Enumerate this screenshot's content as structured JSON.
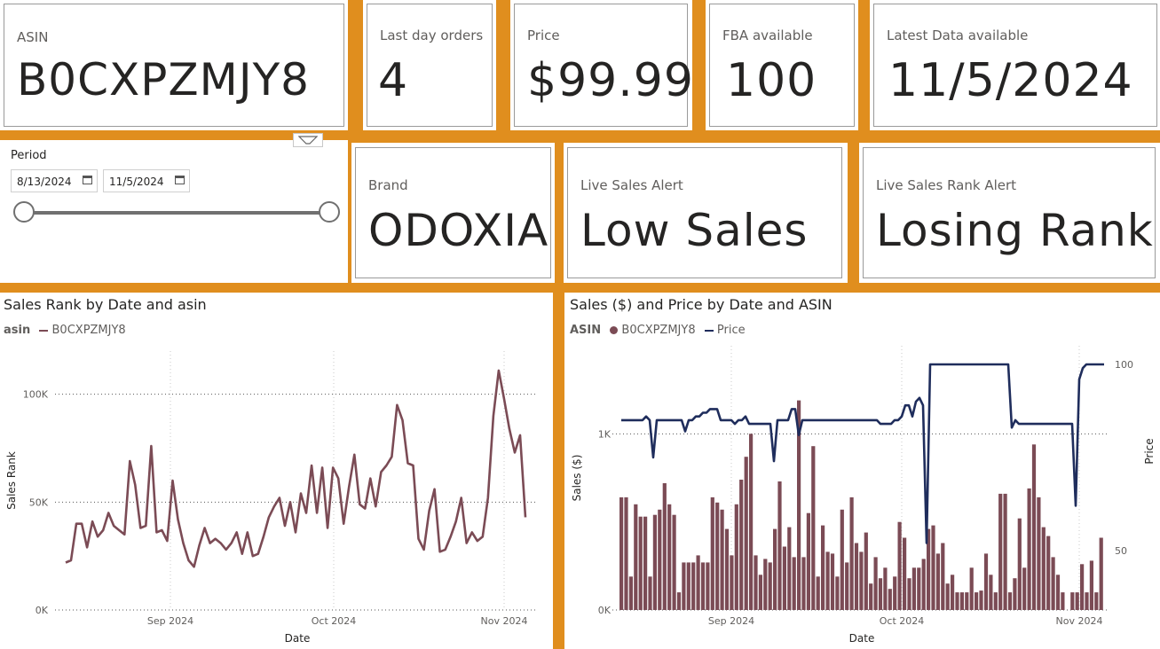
{
  "cards_top": [
    {
      "label": "ASIN",
      "value": "B0CXPZMJY8"
    },
    {
      "label": "Last day orders",
      "value": "4"
    },
    {
      "label": "Price",
      "value": "$99.99"
    },
    {
      "label": "FBA available",
      "value": "100"
    },
    {
      "label": "Latest Data available",
      "value": "11/5/2024"
    }
  ],
  "cards_mid": [
    {
      "label": "Brand",
      "value": "ODOXIA"
    },
    {
      "label": "Live Sales Alert",
      "value": "Low Sales"
    },
    {
      "label": "Live Sales Rank Alert",
      "value": "Losing Rank"
    }
  ],
  "period": {
    "label": "Period",
    "start": "8/13/2024",
    "end": "11/5/2024",
    "icon": "calendar-icon",
    "filter_icon": "filter-icon"
  },
  "colors": {
    "accent": "#E08E1E",
    "series_maroon": "#7B4B55",
    "series_navy": "#1F2D5C"
  },
  "chart_data": [
    {
      "type": "line",
      "title": "Sales Rank by Date and asin",
      "legend_title": "asin",
      "xlabel": "Date",
      "ylabel": "Sales Rank",
      "x_ticks": [
        "Sep 2024",
        "Oct 2024",
        "Nov 2024"
      ],
      "y_ticks": [
        "0K",
        "50K",
        "100K"
      ],
      "ylim": [
        0,
        120000
      ],
      "series": [
        {
          "name": "B0CXPZMJY8",
          "values": [
            22000,
            23000,
            40000,
            40000,
            29000,
            41000,
            34000,
            37000,
            45000,
            39000,
            37000,
            35000,
            69000,
            58000,
            38000,
            39000,
            76000,
            36000,
            37000,
            32000,
            60000,
            42000,
            31000,
            23000,
            20000,
            30000,
            38000,
            31000,
            33000,
            31000,
            28000,
            31000,
            36000,
            26000,
            36000,
            25000,
            26000,
            34000,
            43000,
            48000,
            52000,
            39000,
            50000,
            36000,
            54000,
            45000,
            67000,
            45000,
            66000,
            38000,
            66000,
            61000,
            40000,
            57000,
            72000,
            49000,
            47000,
            61000,
            48000,
            64000,
            67000,
            71000,
            95000,
            88000,
            68000,
            67000,
            33000,
            28000,
            46000,
            56000,
            27000,
            28000,
            34000,
            41000,
            52000,
            31000,
            36000,
            32000,
            34000,
            52000,
            90000,
            111000,
            98000,
            84000,
            73000,
            81000,
            43000
          ]
        }
      ]
    },
    {
      "type": "bar",
      "title": "Sales ($) and Price by Date and ASIN",
      "legend_title": "ASIN",
      "xlabel": "Date",
      "ylabel": "Sales ($)",
      "y2label": "Price",
      "x_ticks": [
        "Sep 2024",
        "Oct 2024",
        "Nov 2024"
      ],
      "y_ticks": [
        "0K",
        "1K"
      ],
      "y2_ticks": [
        "50",
        "100"
      ],
      "ylim": [
        0,
        1500
      ],
      "y2lim": [
        34,
        105
      ],
      "series": [
        {
          "name": "B0CXPZMJY8",
          "type": "bar",
          "values": [
            640,
            640,
            190,
            600,
            530,
            530,
            190,
            540,
            570,
            720,
            600,
            540,
            100,
            270,
            270,
            270,
            310,
            270,
            270,
            640,
            610,
            570,
            460,
            310,
            600,
            740,
            870,
            1000,
            310,
            200,
            290,
            270,
            460,
            730,
            360,
            470,
            300,
            1190,
            300,
            550,
            930,
            190,
            480,
            330,
            320,
            190,
            570,
            270,
            640,
            380,
            330,
            440,
            150,
            300,
            180,
            240,
            120,
            190,
            500,
            410,
            180,
            240,
            240,
            290,
            460,
            480,
            320,
            380,
            150,
            200,
            100,
            100,
            100,
            240,
            100,
            110,
            320,
            200,
            100,
            660,
            660,
            100,
            180,
            520,
            240,
            690,
            940,
            640,
            470,
            420,
            300,
            200,
            100,
            0,
            100,
            100,
            260,
            100,
            280,
            100,
            410
          ]
        },
        {
          "name": "Price",
          "type": "line",
          "values": [
            85,
            85,
            85,
            85,
            85,
            85,
            85,
            86,
            85,
            75,
            85,
            85,
            85,
            85,
            85,
            85,
            85,
            85,
            82,
            85,
            85,
            86,
            86,
            87,
            87,
            88,
            88,
            88,
            85,
            85,
            85,
            85,
            84,
            85,
            85,
            86,
            84,
            84,
            84,
            84,
            84,
            84,
            84,
            74,
            85,
            85,
            85,
            85,
            88,
            88,
            81,
            85,
            85,
            85,
            85,
            85,
            85,
            85,
            85,
            85,
            85,
            85,
            85,
            85,
            85,
            85,
            85,
            85,
            85,
            85,
            85,
            85,
            85,
            84,
            84,
            84,
            84,
            85,
            85,
            86,
            89,
            89,
            86,
            90,
            91,
            89,
            52,
            100,
            100,
            100,
            100,
            100,
            100,
            100,
            100,
            100,
            100,
            100,
            100,
            100,
            100,
            100,
            100,
            100,
            100,
            100,
            100,
            100,
            100,
            100,
            83,
            85,
            84,
            84,
            84,
            84,
            84,
            84,
            84,
            84,
            84,
            84,
            84,
            84,
            84,
            84,
            84,
            84,
            62,
            96,
            99,
            100,
            100,
            100,
            100,
            100,
            100
          ]
        }
      ]
    }
  ]
}
